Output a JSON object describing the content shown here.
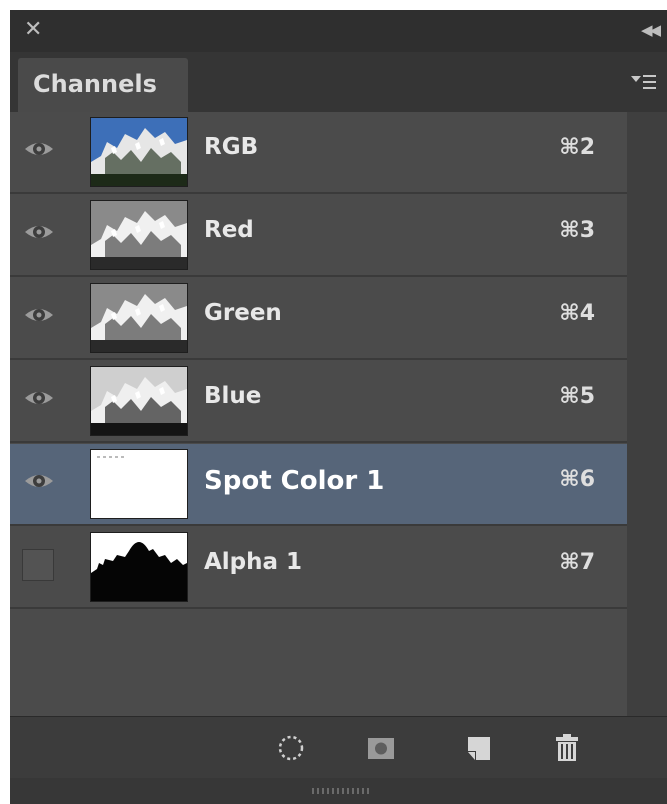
{
  "panel": {
    "close_icon": "close-icon",
    "collapse_icon": "double-chevron-left-icon",
    "tab_label": "Channels",
    "menu_icon": "panel-menu-icon"
  },
  "channels": [
    {
      "name": "RGB",
      "shortcut": "⌘2",
      "visible": true,
      "selected": false,
      "thumb": "rgb"
    },
    {
      "name": "Red",
      "shortcut": "⌘3",
      "visible": true,
      "selected": false,
      "thumb": "gray"
    },
    {
      "name": "Green",
      "shortcut": "⌘4",
      "visible": true,
      "selected": false,
      "thumb": "gray"
    },
    {
      "name": "Blue",
      "shortcut": "⌘5",
      "visible": true,
      "selected": false,
      "thumb": "gray-dark"
    },
    {
      "name": "Spot Color 1",
      "shortcut": "⌘6",
      "visible": true,
      "selected": true,
      "thumb": "white"
    },
    {
      "name": "Alpha 1",
      "shortcut": "⌘7",
      "visible": false,
      "selected": false,
      "thumb": "silhouette"
    }
  ],
  "footer": {
    "buttons": [
      {
        "icon": "load-selection-icon"
      },
      {
        "icon": "save-selection-as-channel-icon"
      },
      {
        "icon": "new-channel-icon"
      },
      {
        "icon": "delete-channel-icon"
      }
    ]
  },
  "colors": {
    "panel_bg": "#474747",
    "selected_row": "#566579",
    "text": "#e8e8e8"
  }
}
